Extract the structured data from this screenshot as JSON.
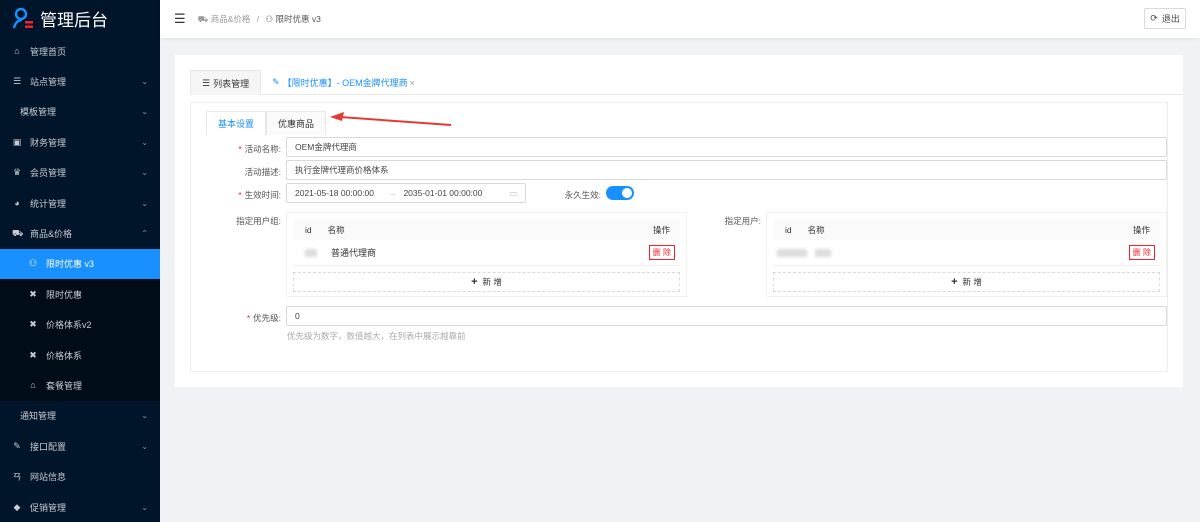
{
  "app": {
    "title": "管理后台"
  },
  "sidebar": {
    "items": [
      {
        "label": "管理首页",
        "icon": "home-icon"
      },
      {
        "label": "站点管理",
        "icon": "database-icon"
      },
      {
        "label": "模板管理"
      },
      {
        "label": "财务管理",
        "icon": "wallet-icon"
      },
      {
        "label": "会员管理",
        "icon": "crown-icon"
      },
      {
        "label": "统计管理",
        "icon": "pie-chart-icon"
      },
      {
        "label": "商品&价格",
        "icon": "cart-icon"
      },
      {
        "label": "限时优惠 v3",
        "icon": "user-icon"
      },
      {
        "label": "限时优惠",
        "icon": "cross-icon"
      },
      {
        "label": "价格体系v2",
        "icon": "cross-icon"
      },
      {
        "label": "价格体系",
        "icon": "cross-icon"
      },
      {
        "label": "套餐管理",
        "icon": "shop-icon"
      },
      {
        "label": "通知管理"
      },
      {
        "label": "接口配置",
        "icon": "plug-icon"
      },
      {
        "label": "网站信息",
        "icon": "info-icon"
      },
      {
        "label": "促销管理",
        "icon": "tag-icon"
      }
    ]
  },
  "header": {
    "crumb1": "商品&价格",
    "sep": "/",
    "crumb2": "限时优惠 v3",
    "logout": "退出"
  },
  "tabs": {
    "list": "列表管理",
    "current": "【限时优惠】- OEM金牌代理商"
  },
  "form": {
    "tab_basic": "基本设置",
    "tab_goods": "优惠商品",
    "name_label": "活动名称:",
    "name_value": "OEM金牌代理商",
    "desc_label": "活动描述:",
    "desc_value": "执行金牌代理商价格体系",
    "time_label": "生效时间:",
    "start": "2021-05-18 00:00:00",
    "arrow": "→",
    "end": "2035-01-01 00:00:00",
    "forever_label": "永久生效:",
    "forever": true,
    "group_label": "指定用户组:",
    "user_label": "指定用户:",
    "col_id": "id",
    "col_name": "名称",
    "col_op": "操作",
    "group_row_name": "普通代理商",
    "delete": "删 除",
    "add": "新 增",
    "priority_label": "优先级:",
    "priority_value": "0",
    "priority_hint": "优先级为数字，数值越大，在列表中展示越靠前"
  },
  "colors": {
    "accent": "#1890ff",
    "sidebar": "#001529",
    "danger": "#f5222d"
  }
}
